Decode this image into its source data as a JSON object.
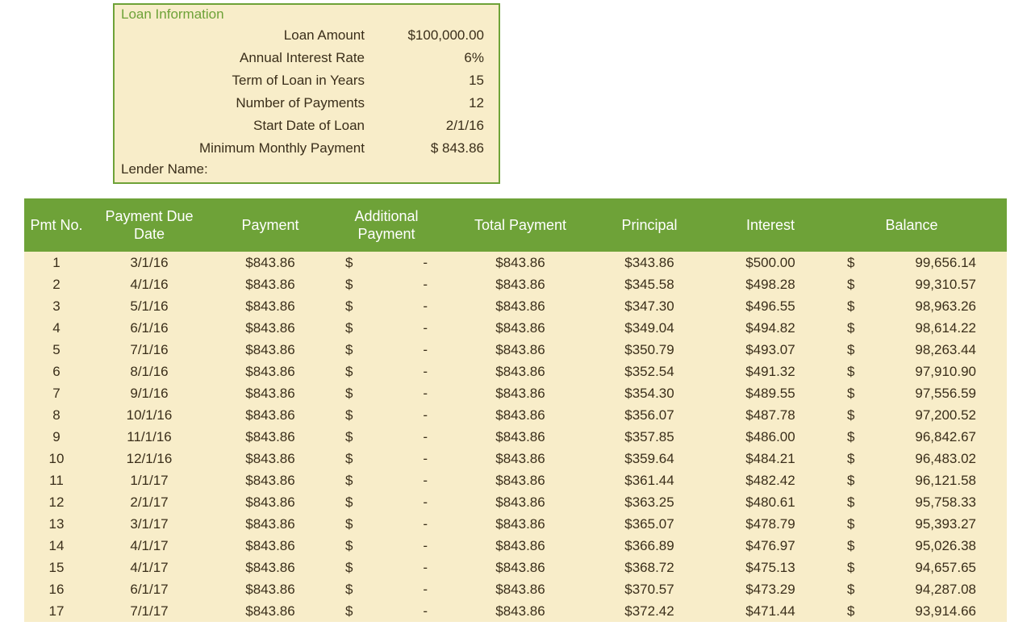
{
  "loanInfo": {
    "title": "Loan Information",
    "rows": [
      {
        "label": "Loan Amount",
        "value": "$100,000.00"
      },
      {
        "label": "Annual Interest Rate",
        "value": "6%"
      },
      {
        "label": "Term of Loan in Years",
        "value": "15"
      },
      {
        "label": "Number of Payments",
        "value": "12"
      },
      {
        "label": "Start Date of Loan",
        "value": "2/1/16"
      },
      {
        "label": "Minimum Monthly Payment",
        "value": "$      843.86"
      }
    ],
    "lenderLabel": "Lender Name:"
  },
  "table": {
    "headers": {
      "no": "Pmt No.",
      "date": "Payment Due Date",
      "payment": "Payment",
      "additional": "Additional Payment",
      "total": "Total Payment",
      "principal": "Principal",
      "interest": "Interest",
      "balance": "Balance"
    },
    "rows": [
      {
        "no": "1",
        "date": "3/1/16",
        "payment": "$843.86",
        "addSym": "$",
        "addVal": "-",
        "total": "$843.86",
        "principal": "$343.86",
        "interest": "$500.00",
        "balSym": "$",
        "balVal": "99,656.14"
      },
      {
        "no": "2",
        "date": "4/1/16",
        "payment": "$843.86",
        "addSym": "$",
        "addVal": "-",
        "total": "$843.86",
        "principal": "$345.58",
        "interest": "$498.28",
        "balSym": "$",
        "balVal": "99,310.57"
      },
      {
        "no": "3",
        "date": "5/1/16",
        "payment": "$843.86",
        "addSym": "$",
        "addVal": "-",
        "total": "$843.86",
        "principal": "$347.30",
        "interest": "$496.55",
        "balSym": "$",
        "balVal": "98,963.26"
      },
      {
        "no": "4",
        "date": "6/1/16",
        "payment": "$843.86",
        "addSym": "$",
        "addVal": "-",
        "total": "$843.86",
        "principal": "$349.04",
        "interest": "$494.82",
        "balSym": "$",
        "balVal": "98,614.22"
      },
      {
        "no": "5",
        "date": "7/1/16",
        "payment": "$843.86",
        "addSym": "$",
        "addVal": "-",
        "total": "$843.86",
        "principal": "$350.79",
        "interest": "$493.07",
        "balSym": "$",
        "balVal": "98,263.44"
      },
      {
        "no": "6",
        "date": "8/1/16",
        "payment": "$843.86",
        "addSym": "$",
        "addVal": "-",
        "total": "$843.86",
        "principal": "$352.54",
        "interest": "$491.32",
        "balSym": "$",
        "balVal": "97,910.90"
      },
      {
        "no": "7",
        "date": "9/1/16",
        "payment": "$843.86",
        "addSym": "$",
        "addVal": "-",
        "total": "$843.86",
        "principal": "$354.30",
        "interest": "$489.55",
        "balSym": "$",
        "balVal": "97,556.59"
      },
      {
        "no": "8",
        "date": "10/1/16",
        "payment": "$843.86",
        "addSym": "$",
        "addVal": "-",
        "total": "$843.86",
        "principal": "$356.07",
        "interest": "$487.78",
        "balSym": "$",
        "balVal": "97,200.52"
      },
      {
        "no": "9",
        "date": "11/1/16",
        "payment": "$843.86",
        "addSym": "$",
        "addVal": "-",
        "total": "$843.86",
        "principal": "$357.85",
        "interest": "$486.00",
        "balSym": "$",
        "balVal": "96,842.67"
      },
      {
        "no": "10",
        "date": "12/1/16",
        "payment": "$843.86",
        "addSym": "$",
        "addVal": "-",
        "total": "$843.86",
        "principal": "$359.64",
        "interest": "$484.21",
        "balSym": "$",
        "balVal": "96,483.02"
      },
      {
        "no": "11",
        "date": "1/1/17",
        "payment": "$843.86",
        "addSym": "$",
        "addVal": "-",
        "total": "$843.86",
        "principal": "$361.44",
        "interest": "$482.42",
        "balSym": "$",
        "balVal": "96,121.58"
      },
      {
        "no": "12",
        "date": "2/1/17",
        "payment": "$843.86",
        "addSym": "$",
        "addVal": "-",
        "total": "$843.86",
        "principal": "$363.25",
        "interest": "$480.61",
        "balSym": "$",
        "balVal": "95,758.33"
      },
      {
        "no": "13",
        "date": "3/1/17",
        "payment": "$843.86",
        "addSym": "$",
        "addVal": "-",
        "total": "$843.86",
        "principal": "$365.07",
        "interest": "$478.79",
        "balSym": "$",
        "balVal": "95,393.27"
      },
      {
        "no": "14",
        "date": "4/1/17",
        "payment": "$843.86",
        "addSym": "$",
        "addVal": "-",
        "total": "$843.86",
        "principal": "$366.89",
        "interest": "$476.97",
        "balSym": "$",
        "balVal": "95,026.38"
      },
      {
        "no": "15",
        "date": "4/1/17",
        "payment": "$843.86",
        "addSym": "$",
        "addVal": "-",
        "total": "$843.86",
        "principal": "$368.72",
        "interest": "$475.13",
        "balSym": "$",
        "balVal": "94,657.65"
      },
      {
        "no": "16",
        "date": "6/1/17",
        "payment": "$843.86",
        "addSym": "$",
        "addVal": "-",
        "total": "$843.86",
        "principal": "$370.57",
        "interest": "$473.29",
        "balSym": "$",
        "balVal": "94,287.08"
      },
      {
        "no": "17",
        "date": "7/1/17",
        "payment": "$843.86",
        "addSym": "$",
        "addVal": "-",
        "total": "$843.86",
        "principal": "$372.42",
        "interest": "$471.44",
        "balSym": "$",
        "balVal": "93,914.66"
      }
    ]
  }
}
